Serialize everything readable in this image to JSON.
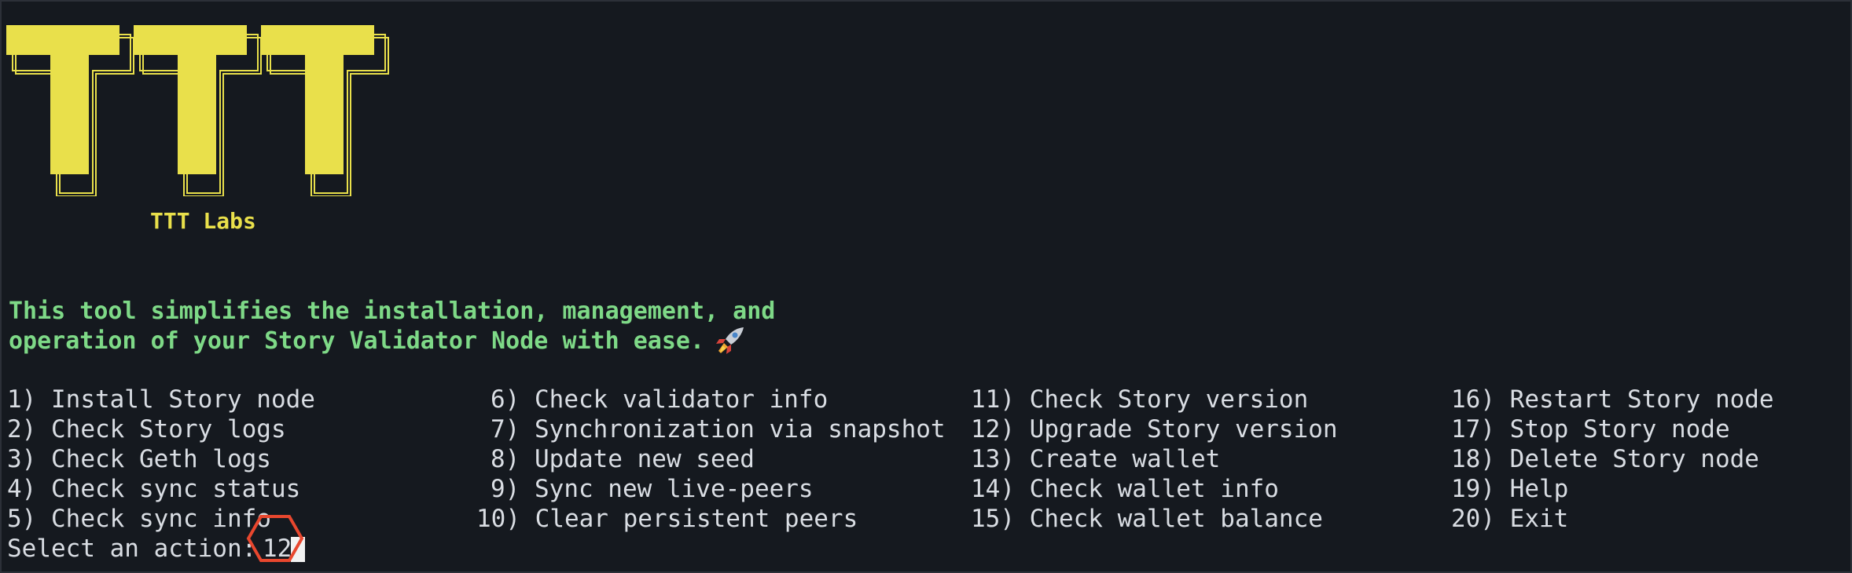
{
  "logo": {
    "letters": "TTT",
    "fill_color": "#e9e04b",
    "outline_color": "#e9e04b"
  },
  "brand": "TTT Labs",
  "tagline": {
    "line1": "This tool simplifies the installation, management, and",
    "line2": "operation of your Story Validator Node with ease.",
    "emoji": "rocket-icon"
  },
  "menu": {
    "items": [
      "1) Install Story node",
      "2) Check Story logs",
      "3) Check Geth logs",
      "4) Check sync status",
      "5) Check sync info",
      "6) Check validator info",
      "7) Synchronization via snapshot",
      "8) Update new seed",
      "9) Sync new live-peers",
      "10) Clear persistent peers",
      "11) Check Story version",
      "12) Upgrade Story version",
      "13) Create wallet",
      "14) Check wallet info",
      "15) Check wallet balance",
      "16) Restart Story node",
      "17) Stop Story node",
      "18) Delete Story node",
      "19) Help",
      "20) Exit"
    ]
  },
  "prompt": {
    "label": "Select an action: ",
    "value": "12"
  },
  "colors": {
    "background": "#15191f",
    "text": "#d9dde3",
    "logo_yellow": "#e9e04b",
    "tagline_green": "#7ed987",
    "annotation_red": "#e8472e"
  }
}
